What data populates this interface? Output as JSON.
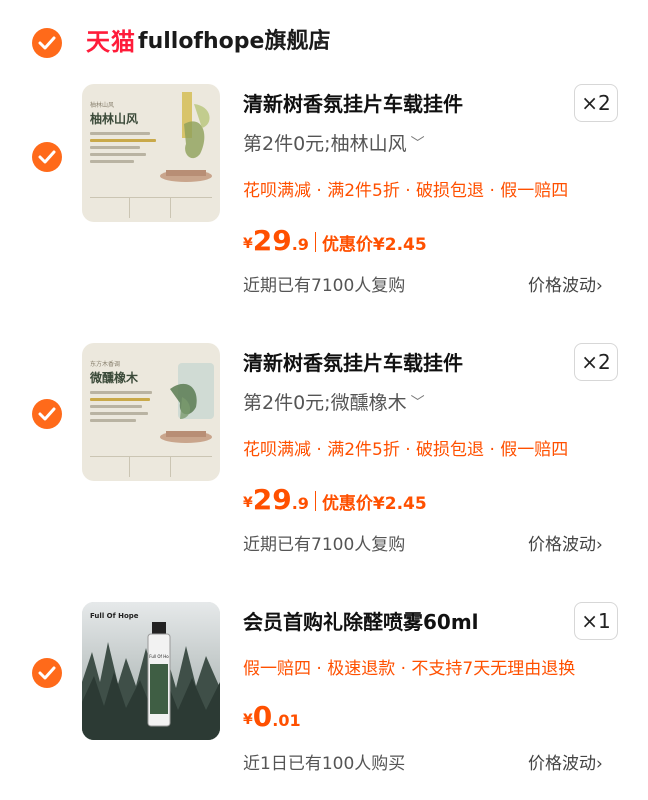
{
  "store": {
    "logo_text": "天猫",
    "name": "fullofhope旗舰店",
    "chevron": "›"
  },
  "items": [
    {
      "title": "清新树香氛挂片车载挂件",
      "quantity": "×2",
      "sku": "第2件0元;柚林山风",
      "promos": "花呗满减 · 满2件5折 · 破损包退 · 假一赔四",
      "price_symbol": "¥",
      "price_int": "29",
      "price_dec": ".9",
      "promo_price": "优惠价¥2.45",
      "note": "近期已有7100人复购",
      "trend": "价格波动",
      "thumb_title": "柚林山风"
    },
    {
      "title": "清新树香氛挂片车载挂件",
      "quantity": "×2",
      "sku": "第2件0元;微醺橡木",
      "promos": "花呗满减 · 满2件5折 · 破损包退 · 假一赔四",
      "price_symbol": "¥",
      "price_int": "29",
      "price_dec": ".9",
      "promo_price": "优惠价¥2.45",
      "note": "近期已有7100人复购",
      "trend": "价格波动",
      "thumb_title": "微醺橡木"
    },
    {
      "title": "会员首购礼除醛喷雾60ml",
      "quantity": "×1",
      "promos": "假一赔四 · 极速退款 · 不支持7天无理由退换",
      "price_symbol": "¥",
      "price_int": "0",
      "price_dec": ".01",
      "note": "近1日已有100人购买",
      "trend": "价格波动",
      "thumb_brand": "Full Of Hope",
      "bottle_label": "Full Of Ho"
    }
  ],
  "colors": {
    "accent": "#ff5000",
    "check": "#ff6a1a",
    "tmall_red": "#ff1c3a"
  },
  "icons": {
    "check": "check-icon",
    "chevron": "chevron-right-icon",
    "dropdown": "chevron-down-icon"
  }
}
